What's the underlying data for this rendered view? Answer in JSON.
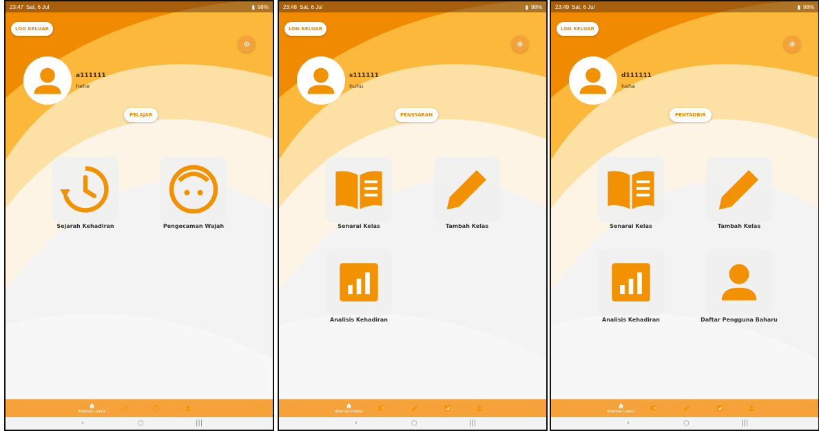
{
  "colors": {
    "accent": "#f08a00",
    "nav": "#f5a23a",
    "tile_icon": "#f39200"
  },
  "panels": [
    {
      "status": {
        "time": "23:47",
        "date": "Sat, 6 Jul",
        "battery": "98%"
      },
      "logout_label": "LOG KELUAR",
      "username": "a111111",
      "subname": "hehe",
      "role": "PELAJAR",
      "tiles": [
        {
          "icon": "history-icon",
          "label": "Sejarah Kehadiran"
        },
        {
          "icon": "face-icon",
          "label": "Pengecaman Wajah"
        }
      ],
      "nav": {
        "home_label": "Halaman Utama",
        "icons": [
          "home-icon",
          "history-icon",
          "face-icon",
          "person-icon"
        ]
      }
    },
    {
      "status": {
        "time": "23:48",
        "date": "Sat, 6 Jul",
        "battery": "98%"
      },
      "logout_label": "LOG KELUAR",
      "username": "s111111",
      "subname": "huhu",
      "role": "PENSYARAH",
      "tiles": [
        {
          "icon": "book-icon",
          "label": "Senarai Kelas"
        },
        {
          "icon": "pencil-icon",
          "label": "Tambah Kelas"
        },
        {
          "icon": "chart-icon",
          "label": "Analisis Kehadiran"
        }
      ],
      "nav": {
        "home_label": "Halaman Utama",
        "icons": [
          "home-icon",
          "book-icon",
          "pencil-icon",
          "chart-icon",
          "person-icon"
        ]
      }
    },
    {
      "status": {
        "time": "23:49",
        "date": "Sat, 6 Jul",
        "battery": "98%"
      },
      "logout_label": "LOG KELUAR",
      "username": "d111111",
      "subname": "haha",
      "role": "PENTADBIR",
      "tiles": [
        {
          "icon": "book-icon",
          "label": "Senarai Kelas"
        },
        {
          "icon": "pencil-icon",
          "label": "Tambah Kelas"
        },
        {
          "icon": "chart-icon",
          "label": "Analisis Kehadiran"
        },
        {
          "icon": "person-icon",
          "label": "Daftar Pengguna Baharu"
        }
      ],
      "nav": {
        "home_label": "Halaman Utama",
        "icons": [
          "home-icon",
          "book-icon",
          "pencil-icon",
          "chart-icon",
          "person-icon"
        ]
      }
    }
  ]
}
